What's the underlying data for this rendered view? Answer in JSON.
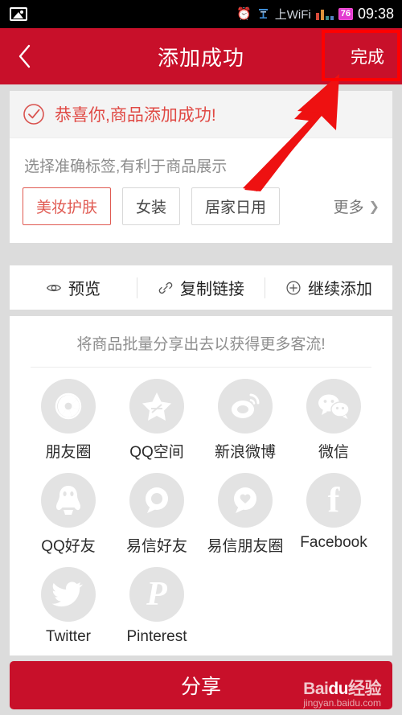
{
  "statusbar": {
    "photo_icon": "photo-icon",
    "alarm_icon": "alarm-clock-icon",
    "wifi_label": "上WiFi",
    "battery_level": "76",
    "time": "09:38"
  },
  "header": {
    "back_icon": "chevron-left-icon",
    "title": "添加成功",
    "done_label": "完成",
    "bg_color": "#c8102a"
  },
  "success_card": {
    "check_icon": "check-circle-icon",
    "success_text": "恭喜你,商品添加成功!",
    "success_color": "#e04a45",
    "hint_text": "选择准确标签,有利于商品展示",
    "tags": [
      {
        "label": "美妆护肤",
        "selected": true
      },
      {
        "label": "女装",
        "selected": false
      },
      {
        "label": "居家日用",
        "selected": false
      }
    ],
    "more_label": "更多",
    "more_icon": "chevron-right-icon"
  },
  "actions": [
    {
      "label": "预览",
      "icon": "eye-icon"
    },
    {
      "label": "复制链接",
      "icon": "link-icon"
    },
    {
      "label": "继续添加",
      "icon": "plus-circle-icon"
    }
  ],
  "share_panel": {
    "title": "将商品批量分享出去以获得更多客流!",
    "targets": [
      {
        "label": "朋友圈",
        "icon": "camera-aperture-icon"
      },
      {
        "label": "QQ空间",
        "icon": "star-icon"
      },
      {
        "label": "新浪微博",
        "icon": "weibo-eye-icon"
      },
      {
        "label": "微信",
        "icon": "wechat-bubbles-icon"
      },
      {
        "label": "QQ好友",
        "icon": "qq-penguin-icon"
      },
      {
        "label": "易信好友",
        "icon": "yixin-circle-icon"
      },
      {
        "label": "易信朋友圈",
        "icon": "yixin-heart-bubble-icon"
      },
      {
        "label": "Facebook",
        "icon": "facebook-f-icon"
      },
      {
        "label": "Twitter",
        "icon": "twitter-bird-icon"
      },
      {
        "label": "Pinterest",
        "icon": "pinterest-p-icon"
      }
    ]
  },
  "footer": {
    "share_label": "分享",
    "watermark_brand": "Bai",
    "watermark_paw": "du",
    "watermark_suffix": "经验",
    "watermark_url": "jingyan.baidu.com"
  },
  "annotations": {
    "highlight_color": "#ff0000",
    "arrow_color": "#ee1111",
    "highlight_target": "完成",
    "arrow_name": "pointer-arrow"
  }
}
